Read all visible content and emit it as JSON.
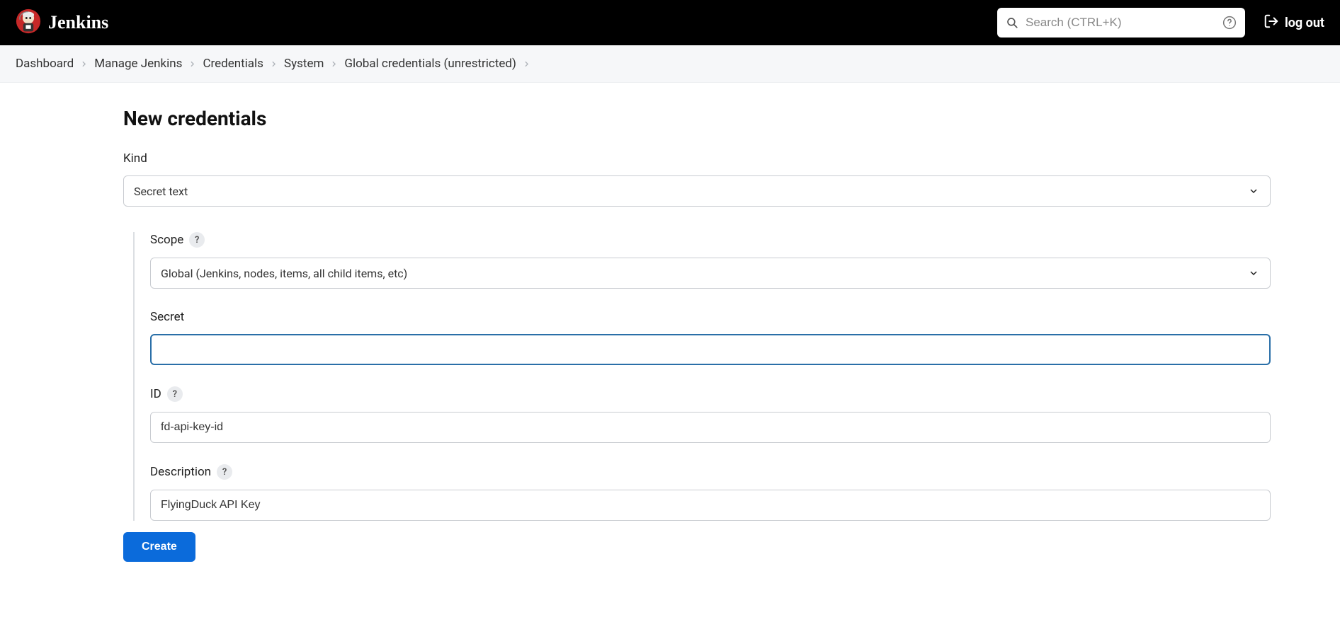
{
  "header": {
    "brand": "Jenkins",
    "search_placeholder": "Search (CTRL+K)",
    "logout_label": "log out"
  },
  "breadcrumb": {
    "items": [
      "Dashboard",
      "Manage Jenkins",
      "Credentials",
      "System",
      "Global credentials (unrestricted)"
    ]
  },
  "page": {
    "title": "New credentials"
  },
  "form": {
    "kind": {
      "label": "Kind",
      "value": "Secret text"
    },
    "scope": {
      "label": "Scope",
      "value": "Global (Jenkins, nodes, items, all child items, etc)"
    },
    "secret": {
      "label": "Secret",
      "value": ""
    },
    "id": {
      "label": "ID",
      "value": "fd-api-key-id"
    },
    "description": {
      "label": "Description",
      "value": "FlyingDuck API Key"
    },
    "create_label": "Create",
    "help_badge": "?"
  }
}
